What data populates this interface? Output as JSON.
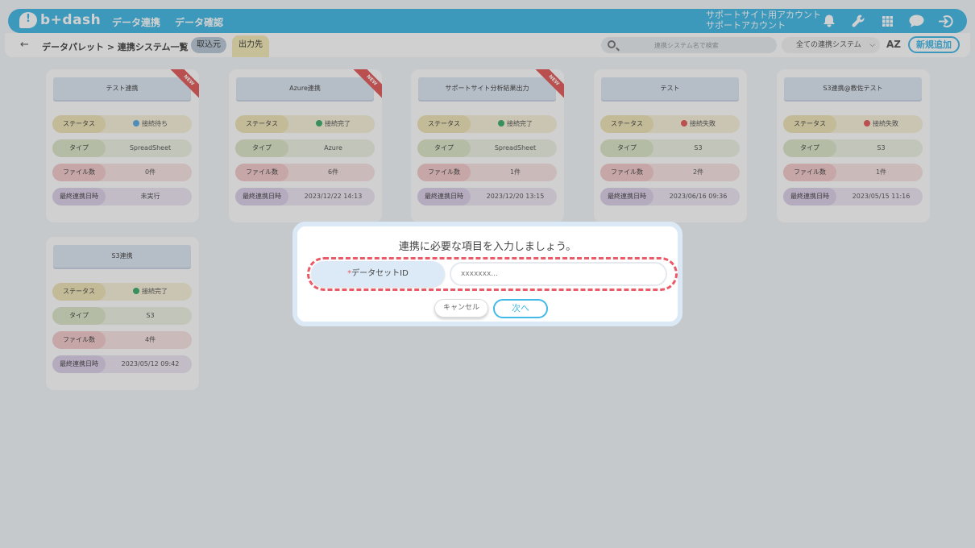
{
  "header": {
    "logo_text": "b+dash",
    "nav": [
      "データ連携",
      "データ確認"
    ],
    "account_line1": "サポートサイト用アカウント",
    "account_line2": "サポートアカウント",
    "icons": [
      "bell-icon",
      "wrench-icon",
      "grid-icon",
      "chat-icon",
      "logout-icon"
    ],
    "accent_color": "#42b9e6"
  },
  "toolbar": {
    "back": "←",
    "breadcrumb": "データパレット > 連携システム一覧",
    "tab_in": "取込元",
    "tab_out": "出力先",
    "search_placeholder": "連携システム名で検索",
    "select_value": "全ての連携システム",
    "sort_label": "AZ",
    "new_button": "新規追加"
  },
  "cards": [
    {
      "title": "テスト連携",
      "new_badge": "NEW",
      "status_label": "ステータス",
      "status": "接続待ち",
      "status_kind": "wait",
      "type_label": "タイプ",
      "type": "SpreadSheet",
      "files_label": "ファイル数",
      "files": "0件",
      "date_label": "最終連携日時",
      "date": "未実行"
    },
    {
      "title": "Azure連携",
      "new_badge": "NEW",
      "status_label": "ステータス",
      "status": "接続完了",
      "status_kind": "ok",
      "type_label": "タイプ",
      "type": "Azure",
      "files_label": "ファイル数",
      "files": "6件",
      "date_label": "最終連携日時",
      "date": "2023/12/22 14:13"
    },
    {
      "title": "サポートサイト分析結果出力",
      "new_badge": "NEW",
      "status_label": "ステータス",
      "status": "接続完了",
      "status_kind": "ok",
      "type_label": "タイプ",
      "type": "SpreadSheet",
      "files_label": "ファイル数",
      "files": "1件",
      "date_label": "最終連携日時",
      "date": "2023/12/20 13:15"
    },
    {
      "title": "テスト",
      "new_badge": "",
      "status_label": "ステータス",
      "status": "接続失敗",
      "status_kind": "fail",
      "type_label": "タイプ",
      "type": "S3",
      "files_label": "ファイル数",
      "files": "2件",
      "date_label": "最終連携日時",
      "date": "2023/06/16 09:36"
    },
    {
      "title": "S3連携@教佐テスト",
      "new_badge": "",
      "status_label": "ステータス",
      "status": "接続失敗",
      "status_kind": "fail",
      "type_label": "タイプ",
      "type": "S3",
      "files_label": "ファイル数",
      "files": "1件",
      "date_label": "最終連携日時",
      "date": "2023/05/15 11:16"
    },
    {
      "title": "S3連携",
      "new_badge": "",
      "status_label": "ステータス",
      "status": "接続完了",
      "status_kind": "ok",
      "type_label": "タイプ",
      "type": "S3",
      "files_label": "ファイル数",
      "files": "4件",
      "date_label": "最終連携日時",
      "date": "2023/05/12 09:42"
    }
  ],
  "modal": {
    "title": "連携に必要な項目を入力しましょう。",
    "required_mark": "*",
    "field_label": "データセットID",
    "field_placeholder": "xxxxxxx...",
    "cancel": "キャンセル",
    "next": "次へ",
    "highlight_color": "#ea5a67"
  }
}
